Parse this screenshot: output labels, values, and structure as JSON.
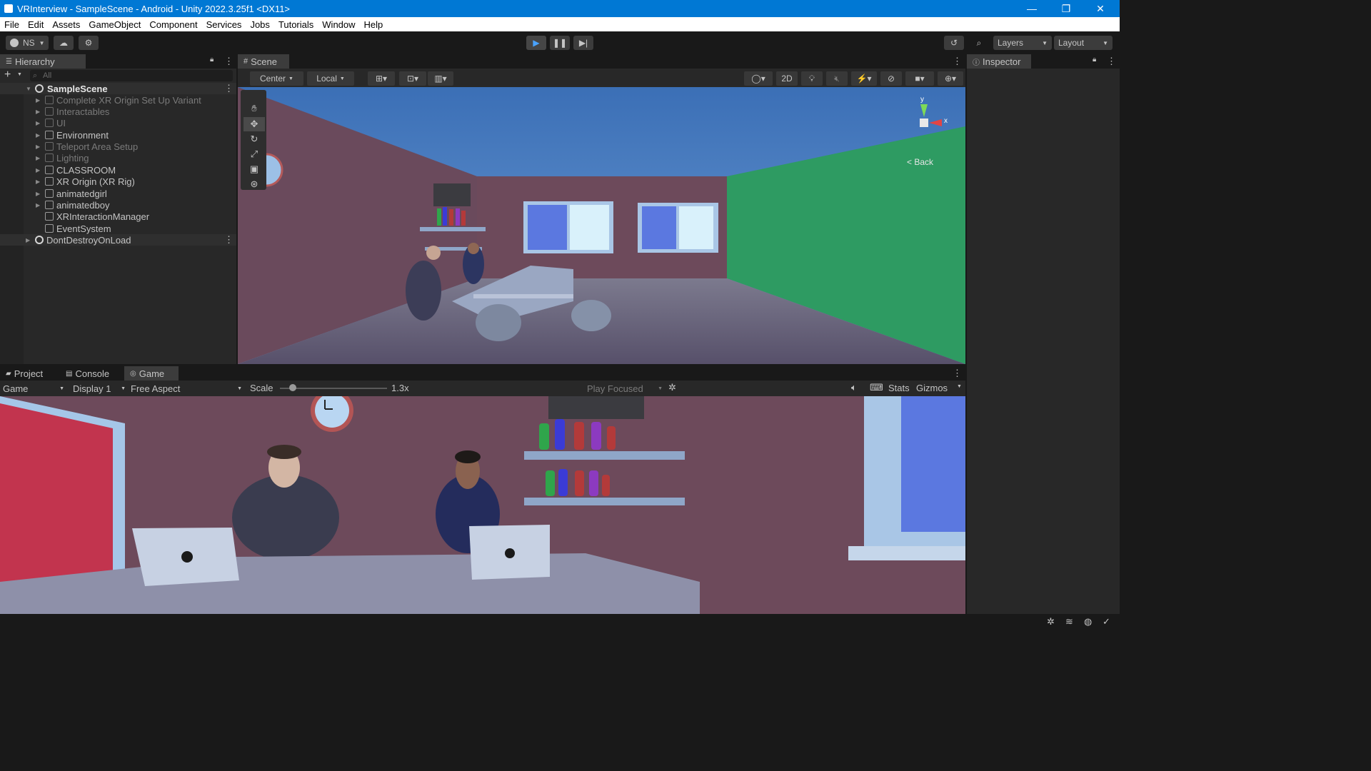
{
  "window": {
    "title": "VRInterview - SampleScene - Android - Unity 2022.3.25f1 <DX11>",
    "minimize": "—",
    "maximize": "❐",
    "close": "✕"
  },
  "menu": [
    "File",
    "Edit",
    "Assets",
    "GameObject",
    "Component",
    "Services",
    "Jobs",
    "Tutorials",
    "Window",
    "Help"
  ],
  "toolbar": {
    "account": "NS",
    "layers": "Layers",
    "layout": "Layout"
  },
  "hierarchy": {
    "tab": "Hierarchy",
    "search_placeholder": "All",
    "scene": "SampleScene",
    "items": [
      {
        "label": "Complete XR Origin Set Up Variant",
        "dim": true
      },
      {
        "label": "Interactables",
        "dim": true
      },
      {
        "label": "UI",
        "dim": true
      },
      {
        "label": "Environment",
        "dim": false
      },
      {
        "label": "Teleport Area Setup",
        "dim": true
      },
      {
        "label": "Lighting",
        "dim": true
      },
      {
        "label": "CLASSROOM",
        "dim": false
      },
      {
        "label": "XR Origin (XR Rig)",
        "dim": false
      },
      {
        "label": "animatedgirl",
        "dim": false
      },
      {
        "label": "animatedboy",
        "dim": false
      },
      {
        "label": "XRInteractionManager",
        "dim": false
      },
      {
        "label": "EventSystem",
        "dim": false
      }
    ],
    "ddol": "DontDestroyOnLoad"
  },
  "scene": {
    "tab": "Scene",
    "pivot": "Center",
    "space": "Local",
    "mode2d": "2D",
    "gizmo_back": "< Back",
    "axis_y": "y",
    "axis_x": "x"
  },
  "inspector": {
    "tab": "Inspector"
  },
  "bottom": {
    "tabs": [
      "Project",
      "Console",
      "Game"
    ],
    "game_view": "Game",
    "display": "Display 1",
    "aspect": "Free Aspect",
    "scale_label": "Scale",
    "scale_value": "1.3x",
    "scale_fraction": 0.12,
    "play_focused": "Play Focused",
    "stats": "Stats",
    "gizmos": "Gizmos"
  },
  "colors": {
    "accent": "#0078d4",
    "wall": "#6d4a5b",
    "green_wall": "#2e9b62",
    "red_wall": "#c2344e",
    "sky": "#3f73b7"
  }
}
